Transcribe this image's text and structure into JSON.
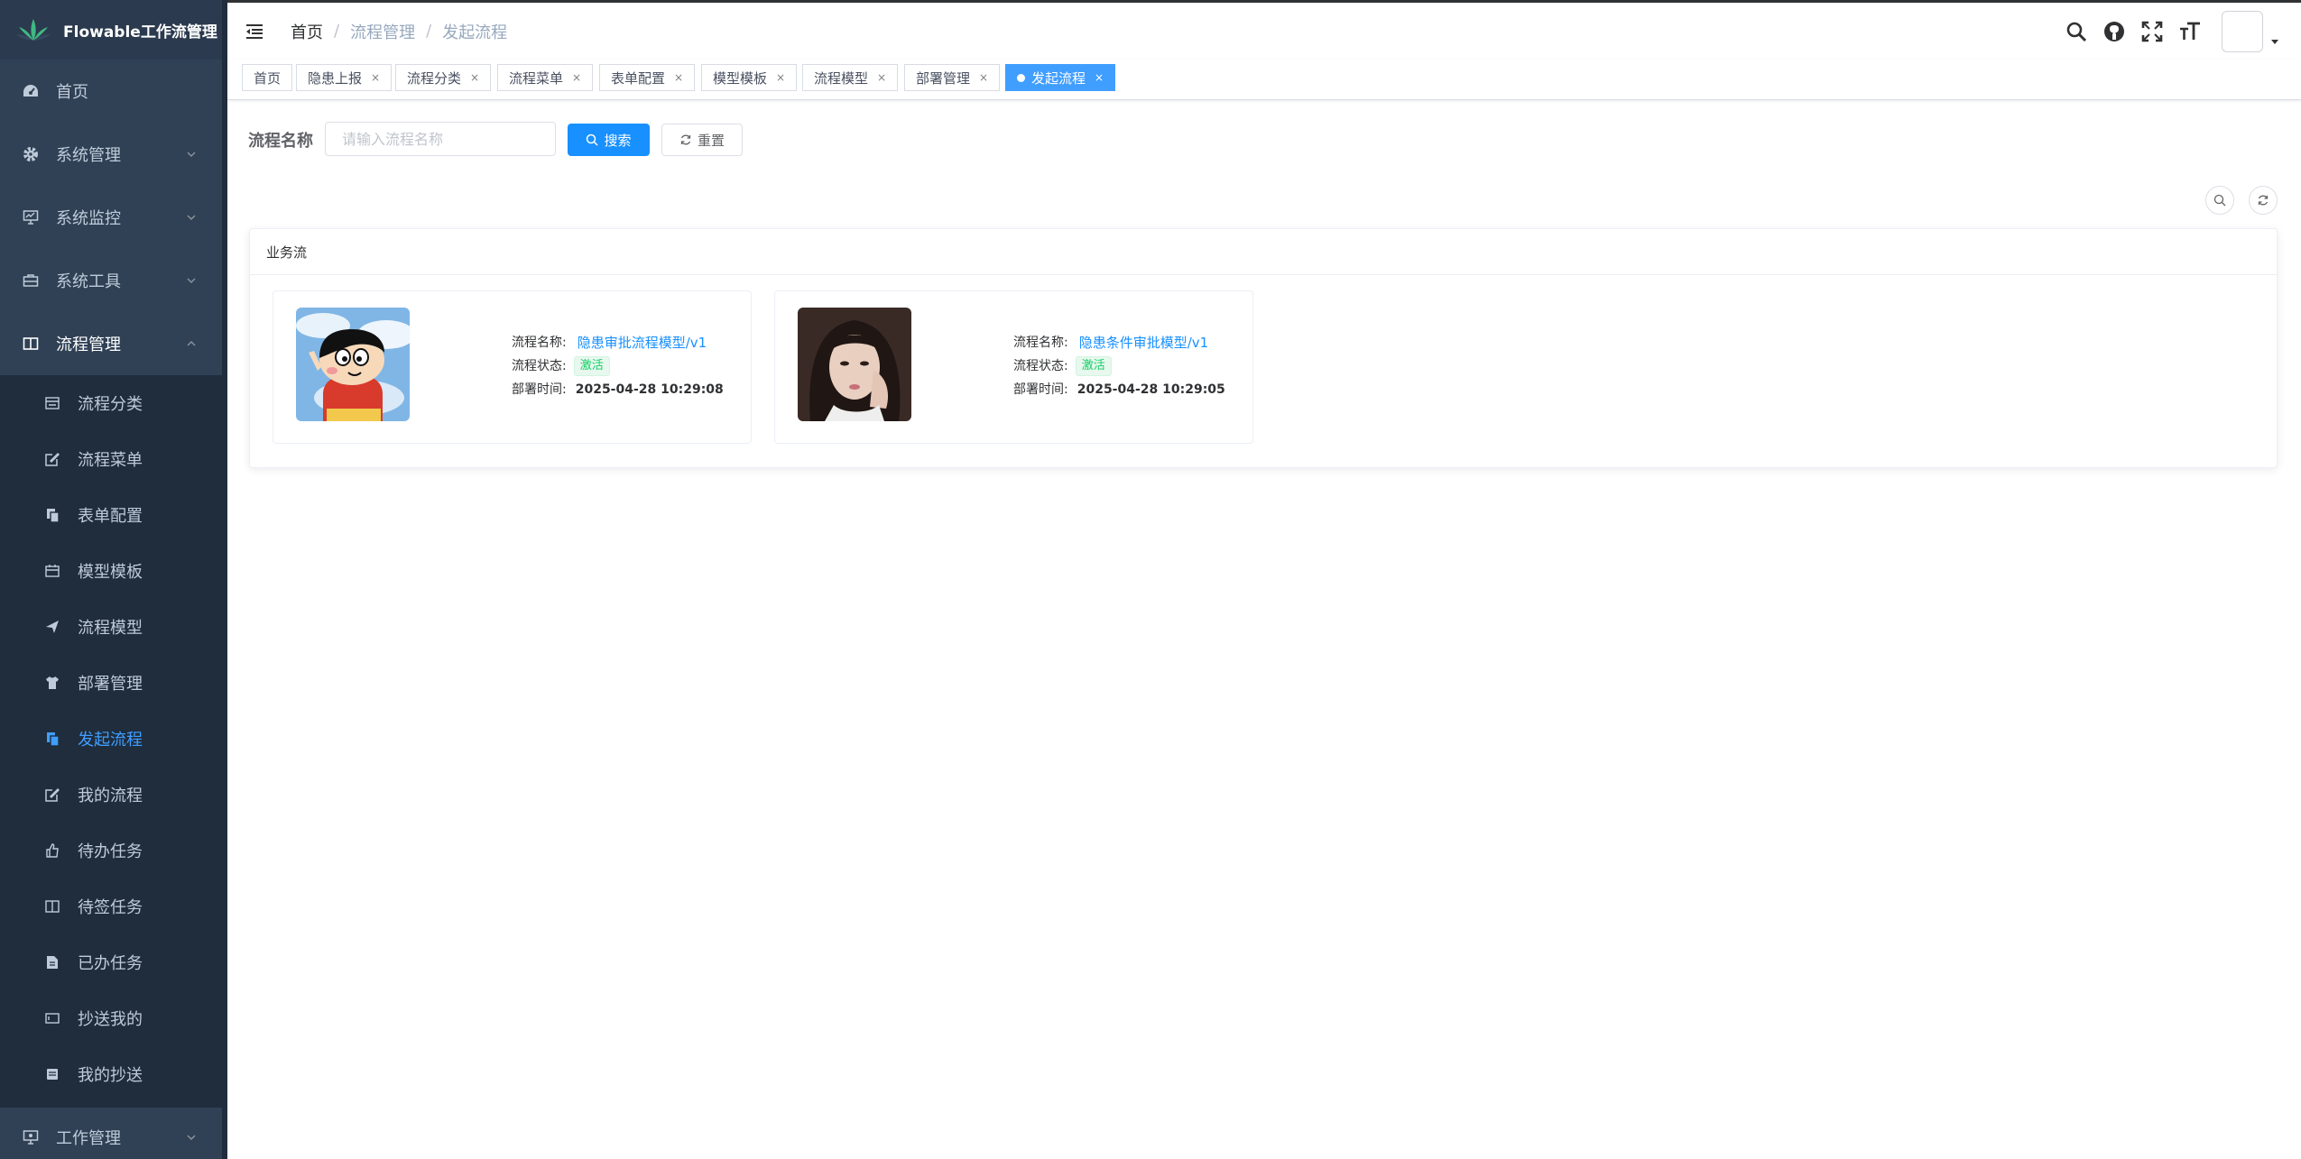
{
  "app": {
    "title": "Flowable工作流管理"
  },
  "sidebar": {
    "items": [
      {
        "label": "首页"
      },
      {
        "label": "系统管理"
      },
      {
        "label": "系统监控"
      },
      {
        "label": "系统工具"
      },
      {
        "label": "流程管理"
      }
    ],
    "sub_items": [
      {
        "label": "流程分类"
      },
      {
        "label": "流程菜单"
      },
      {
        "label": "表单配置"
      },
      {
        "label": "模型模板"
      },
      {
        "label": "流程模型"
      },
      {
        "label": "部署管理"
      },
      {
        "label": "发起流程"
      },
      {
        "label": "我的流程"
      },
      {
        "label": "待办任务"
      },
      {
        "label": "待签任务"
      },
      {
        "label": "已办任务"
      },
      {
        "label": "抄送我的"
      },
      {
        "label": "我的抄送"
      }
    ],
    "bottom_item": {
      "label": "工作管理"
    }
  },
  "breadcrumb": {
    "home": "首页",
    "sep": "/",
    "level1": "流程管理",
    "level2": "发起流程"
  },
  "tags": [
    "首页",
    "隐患上报",
    "流程分类",
    "流程菜单",
    "表单配置",
    "模型模板",
    "流程模型",
    "部署管理",
    "发起流程"
  ],
  "tag_close": "×",
  "search": {
    "label": "流程名称",
    "placeholder": "请输入流程名称",
    "search_button": "搜索",
    "reset_button": "重置"
  },
  "card": {
    "title": "业务流",
    "processes": [
      {
        "name_label": "流程名称:",
        "name": "隐患审批流程模型/v1",
        "status_label": "流程状态:",
        "status": "激活",
        "time_label": "部署时间:",
        "time": "2025-04-28 10:29:08"
      },
      {
        "name_label": "流程名称:",
        "name": "隐患条件审批模型/v1",
        "status_label": "流程状态:",
        "status": "激活",
        "time_label": "部署时间:",
        "time": "2025-04-28 10:29:05"
      }
    ]
  },
  "colors": {
    "sidebar_bg": "#304156",
    "active": "#409eff",
    "primary": "#1890ff",
    "success": "#13ce66"
  }
}
